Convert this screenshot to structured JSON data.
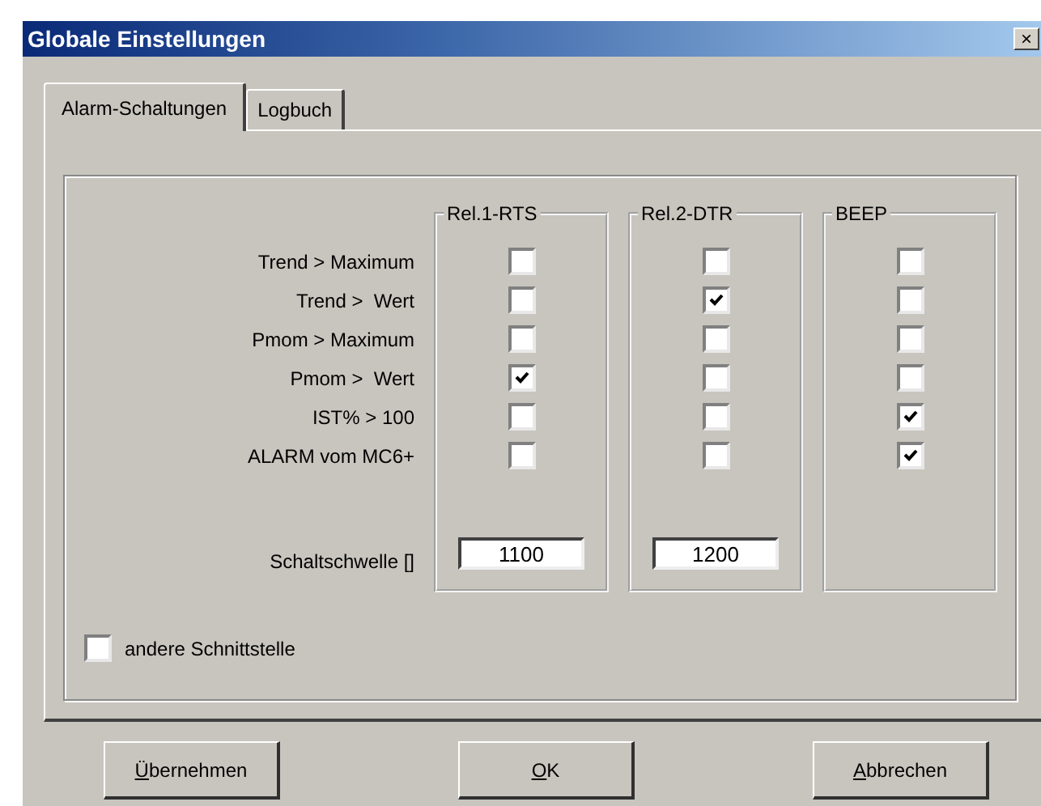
{
  "window": {
    "title": "Globale Einstellungen",
    "close": "×"
  },
  "tabs": [
    {
      "label": "Alarm-Schaltungen",
      "selected": true
    },
    {
      "label": "Logbuch",
      "selected": false
    }
  ],
  "conditions": [
    "Trend > Maximum",
    "Trend >  Wert",
    "Pmom > Maximum",
    "Pmom >  Wert",
    "IST% > 100",
    "ALARM vom MC6+"
  ],
  "threshold_label": "Schaltschwelle []",
  "outputs": [
    {
      "title": "Rel.1-RTS",
      "checked": [
        false,
        false,
        false,
        true,
        false,
        false
      ],
      "threshold": "1100"
    },
    {
      "title": "Rel.2-DTR",
      "checked": [
        false,
        true,
        false,
        false,
        false,
        false
      ],
      "threshold": "1200"
    },
    {
      "title": "BEEP",
      "checked": [
        false,
        false,
        false,
        false,
        true,
        true
      ]
    }
  ],
  "other_interface": {
    "label": "andere Schnittstelle",
    "checked": false
  },
  "buttons": [
    {
      "label": "Übernehmen"
    },
    {
      "label": "OK"
    },
    {
      "label": "Abbrechen"
    }
  ]
}
